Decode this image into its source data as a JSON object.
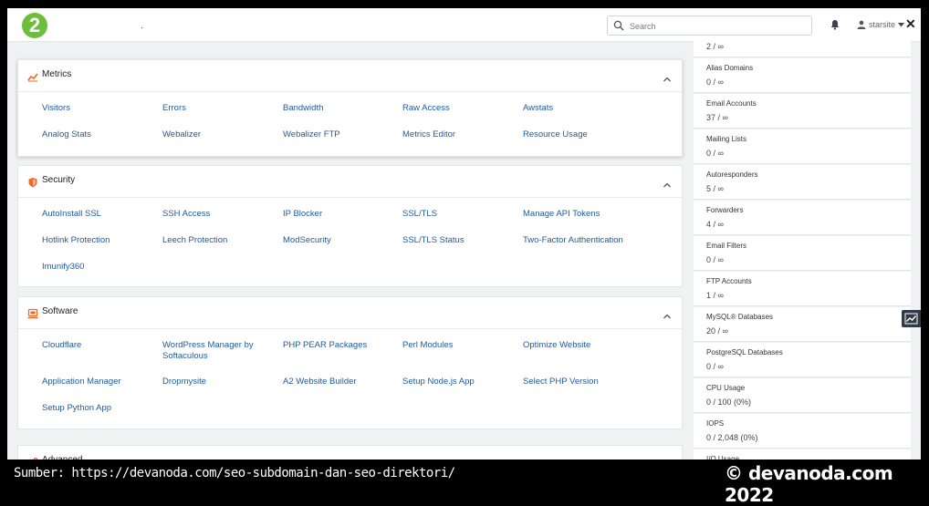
{
  "header": {
    "logo_text": "2",
    "dot": ".",
    "search_placeholder": "Search",
    "username": "starsite",
    "close": "✕"
  },
  "panels": [
    {
      "title": "Metrics",
      "icon": "line-chart-icon",
      "links": [
        "Visitors",
        "Errors",
        "Bandwidth",
        "Raw Access",
        "Awstats",
        "Analog Stats",
        "Webalizer",
        "Webalizer FTP",
        "Metrics Editor",
        "Resource Usage"
      ]
    },
    {
      "title": "Security",
      "icon": "shield-icon",
      "links": [
        "AutoInstall SSL",
        "SSH Access",
        "IP Blocker",
        "SSL/TLS",
        "Manage API Tokens",
        "Hotlink Protection",
        "Leech Protection",
        "ModSecurity",
        "SSL/TLS Status",
        "Two-Factor Authentication",
        "Imunify360"
      ]
    },
    {
      "title": "Software",
      "icon": "software-icon",
      "links": [
        "Cloudflare",
        "WordPress Manager by Softaculous",
        "PHP PEAR Packages",
        "Perl Modules",
        "Optimize Website",
        "Application Manager",
        "Dropmysite",
        "A2 Website Builder",
        "Setup Node.js App",
        "Select PHP Version",
        "Setup Python App"
      ]
    },
    {
      "title": "Advanced",
      "icon": "gears-icon",
      "links": []
    }
  ],
  "stats": [
    {
      "label": "",
      "value": "2 / ∞"
    },
    {
      "label": "Alias Domains",
      "value": "0 / ∞"
    },
    {
      "label": "Email Accounts",
      "value": "37 / ∞"
    },
    {
      "label": "Mailing Lists",
      "value": "0 / ∞"
    },
    {
      "label": "Autoresponders",
      "value": "5 / ∞"
    },
    {
      "label": "Forwarders",
      "value": "4 / ∞"
    },
    {
      "label": "Email Filters",
      "value": "0 / ∞"
    },
    {
      "label": "FTP Accounts",
      "value": "1 / ∞"
    },
    {
      "label": "MySQL® Databases",
      "value": "20 / ∞"
    },
    {
      "label": "PostgreSQL Databases",
      "value": "0 / ∞"
    },
    {
      "label": "CPU Usage",
      "value": "0 / 100   (0%)"
    },
    {
      "label": "IOPS",
      "value": "0 / 2,048   (0%)"
    },
    {
      "label": "I/O Usage",
      "value": ""
    }
  ],
  "caption": {
    "source": "Sumber:  https://devanoda.com/seo-subdomain-dan-seo-direktori/",
    "copyright": "© devanoda.com 2022"
  },
  "colors": {
    "accent": "#f26722",
    "link": "#1f5a9e",
    "logo": "#6cbf3b"
  }
}
